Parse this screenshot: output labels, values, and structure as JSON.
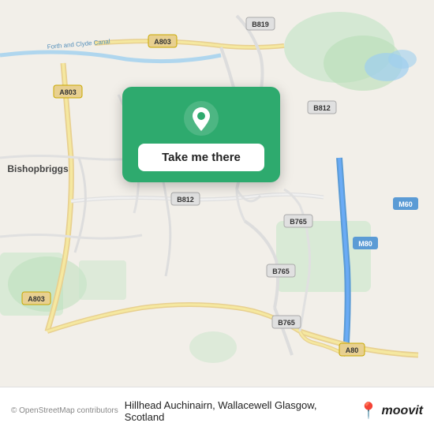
{
  "map": {
    "alt": "Map of Hillhead Auchinairn, Wallacewell Glasgow, Scotland",
    "background_color": "#e8e0d8"
  },
  "popup": {
    "button_label": "Take me there",
    "pin_icon": "location-pin-icon"
  },
  "footer": {
    "copyright": "© OpenStreetMap contributors",
    "location_text": "Hillhead Auchinairn, Wallacewell Glasgow, Scotland",
    "logo_text": "moovit",
    "logo_icon": "moovit-pin-icon"
  },
  "road_labels": {
    "a803_top": "A803",
    "b819": "B819",
    "a803_left": "A803",
    "b812_top_right": "B812",
    "bishopbriggs": "Bishopbriggs",
    "forth_clyde": "Forth and Clyde Canal",
    "b812_center": "B812",
    "b765_top": "B765",
    "b765_mid": "B765",
    "b765_bot": "B765",
    "m80": "M80",
    "m60": "M60",
    "a803_bottom_left": "A803",
    "a80": "A80"
  }
}
